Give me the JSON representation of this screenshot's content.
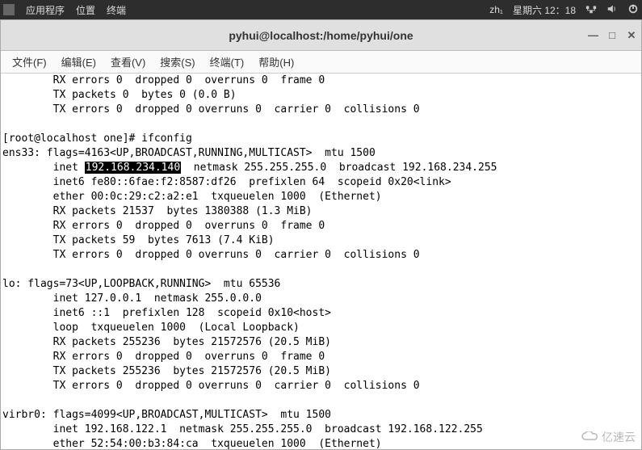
{
  "top_panel": {
    "apps": "应用程序",
    "places": "位置",
    "terminal": "终端",
    "lang": "zh₁",
    "datetime": "星期六 12：18"
  },
  "titlebar": {
    "title": "pyhui@localhost:/home/pyhui/one"
  },
  "menubar": {
    "file": "文件(F)",
    "edit": "编辑(E)",
    "view": "查看(V)",
    "search": "搜索(S)",
    "terminal": "终端(T)",
    "help": "帮助(H)"
  },
  "terminal": {
    "l01": "        RX errors 0  dropped 0  overruns 0  frame 0",
    "l02": "        TX packets 0  bytes 0 (0.0 B)",
    "l03": "        TX errors 0  dropped 0 overruns 0  carrier 0  collisions 0",
    "l04": "",
    "l05_a": "[root@localhost one]# ifconfig",
    "l06": "ens33: flags=4163<UP,BROADCAST,RUNNING,MULTICAST>  mtu 1500",
    "l07_a": "        inet ",
    "l07_hl": "192.168.234.140",
    "l07_b": "  netmask 255.255.255.0  broadcast 192.168.234.255",
    "l08": "        inet6 fe80::6fae:f2:8587:df26  prefixlen 64  scopeid 0x20<link>",
    "l09": "        ether 00:0c:29:c2:a2:e1  txqueuelen 1000  (Ethernet)",
    "l10": "        RX packets 21537  bytes 1380388 (1.3 MiB)",
    "l11": "        RX errors 0  dropped 0  overruns 0  frame 0",
    "l12": "        TX packets 59  bytes 7613 (7.4 KiB)",
    "l13": "        TX errors 0  dropped 0 overruns 0  carrier 0  collisions 0",
    "l14": "",
    "l15": "lo: flags=73<UP,LOOPBACK,RUNNING>  mtu 65536",
    "l16": "        inet 127.0.0.1  netmask 255.0.0.0",
    "l17": "        inet6 ::1  prefixlen 128  scopeid 0x10<host>",
    "l18": "        loop  txqueuelen 1000  (Local Loopback)",
    "l19": "        RX packets 255236  bytes 21572576 (20.5 MiB)",
    "l20": "        RX errors 0  dropped 0  overruns 0  frame 0",
    "l21": "        TX packets 255236  bytes 21572576 (20.5 MiB)",
    "l22": "        TX errors 0  dropped 0 overruns 0  carrier 0  collisions 0",
    "l23": "",
    "l24": "virbr0: flags=4099<UP,BROADCAST,MULTICAST>  mtu 1500",
    "l25": "        inet 192.168.122.1  netmask 255.255.255.0  broadcast 192.168.122.255",
    "l26": "        ether 52:54:00:b3:84:ca  txqueuelen 1000  (Ethernet)"
  },
  "watermark": "亿速云"
}
